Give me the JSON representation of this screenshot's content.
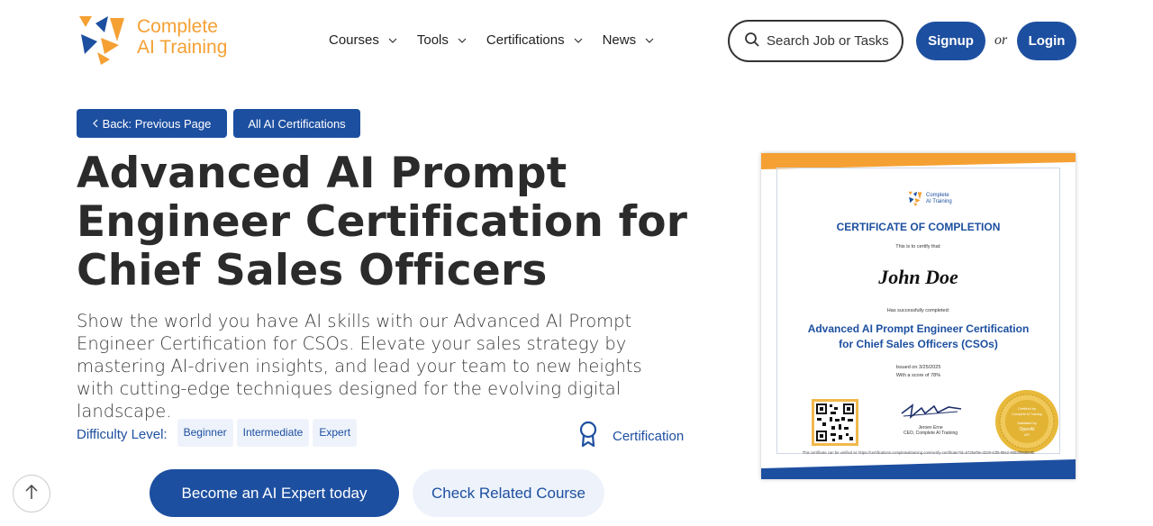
{
  "header": {
    "logo": {
      "line1": "Complete",
      "line2": "AI Training"
    },
    "nav": [
      {
        "label": "Courses"
      },
      {
        "label": "Tools"
      },
      {
        "label": "Certifications"
      },
      {
        "label": "News"
      }
    ],
    "search_placeholder": "Search Job or Tasks",
    "signup_label": "Signup",
    "or_label": "or",
    "login_label": "Login"
  },
  "main": {
    "back_label": "Back: Previous Page",
    "all_certs_label": "All AI Certifications",
    "title": "Advanced AI Prompt Engineer Certification for Chief Sales Officers",
    "description": "Show the world you have AI skills with our Advanced AI Prompt Engineer Certification for CSOs. Elevate your sales strategy by mastering AI-driven insights, and lead your team to new heights with cutting-edge techniques designed for the evolving digital landscape.",
    "difficulty_label": "Difficulty Level:",
    "difficulty_levels": [
      "Beginner",
      "Intermediate",
      "Expert"
    ],
    "certification_label": "Certification",
    "cta_primary": "Become an AI Expert today",
    "cta_secondary": "Check Related Course"
  },
  "certificate": {
    "logo_line1": "Complete",
    "logo_line2": "AI Training",
    "heading": "CERTIFICATE OF COMPLETION",
    "certify_text": "This is to certify that:",
    "name": "John Doe",
    "completed_text": "Has successfully completed:",
    "course_line1": "Advanced AI Prompt Engineer Certification",
    "course_line2": "for Chief Sales Officers (CSOs)",
    "issued": "Issued on 3/25/2025",
    "score": "With a score of 78%",
    "signer_name": "Jeroen Erne",
    "signer_title": "CEO, Complete AI Training",
    "seal_line1": "Certified by",
    "seal_line2": "Complete AI Training",
    "seal_line3": "Validated by",
    "seal_line4": "OpenAI",
    "seal_line5": "API",
    "verify_text": "This certificate can be verified at: https://certifications.completeaitraining.com/verify-certificate?id=6725ef9e-d229-42f5-98e2-8084f99d829b"
  },
  "colors": {
    "brand_blue": "#1d4fa0",
    "brand_orange": "#f5a033",
    "light_blue": "#eef3fb"
  }
}
